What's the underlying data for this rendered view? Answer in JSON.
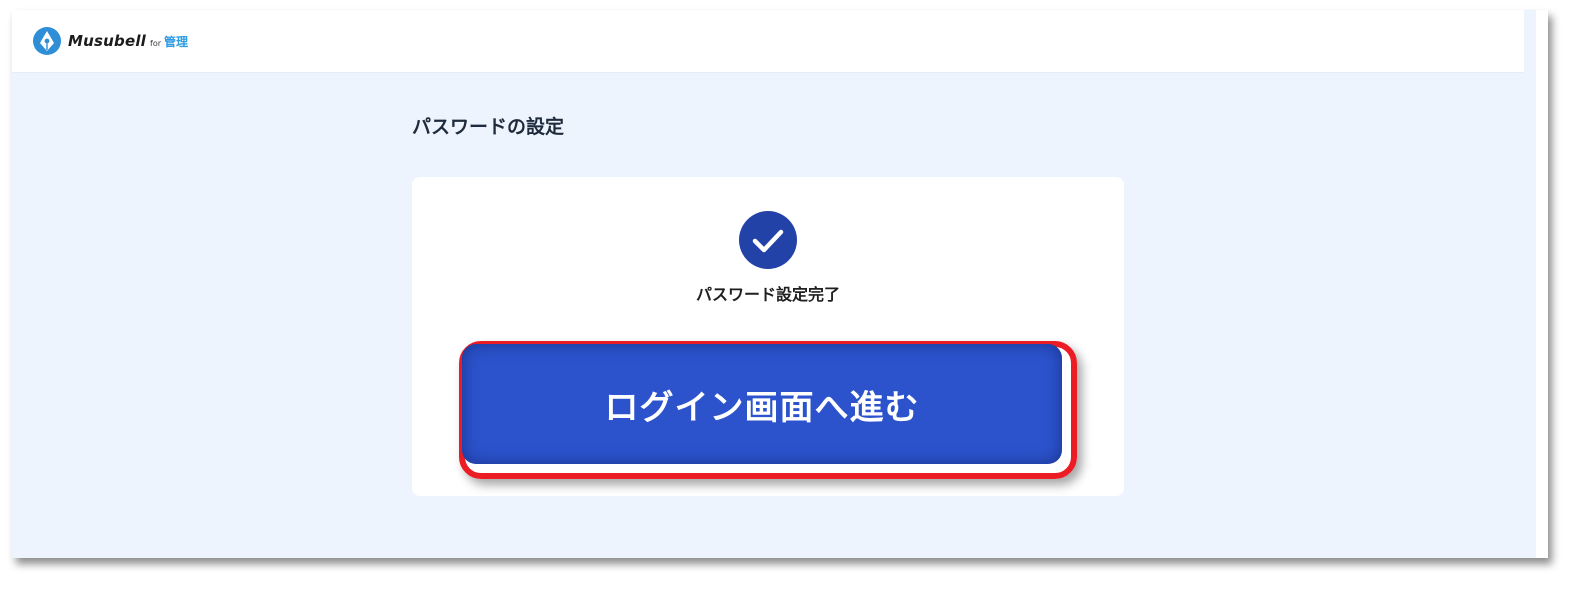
{
  "header": {
    "logo_word": "Musubell",
    "logo_for": "for",
    "logo_kanri": "管理"
  },
  "page": {
    "title": "パスワードの設定"
  },
  "card": {
    "complete_message": "パスワード設定完了",
    "button_label": "ログイン画面へ進む"
  },
  "icons": {
    "logo": "musubell-logo-icon",
    "check": "check-icon"
  },
  "colors": {
    "background": "#edf4fd",
    "check_circle": "#2242a8",
    "button": "#2c53cc",
    "highlight": "#ec1c24",
    "logo_accent": "#2f9be0"
  }
}
